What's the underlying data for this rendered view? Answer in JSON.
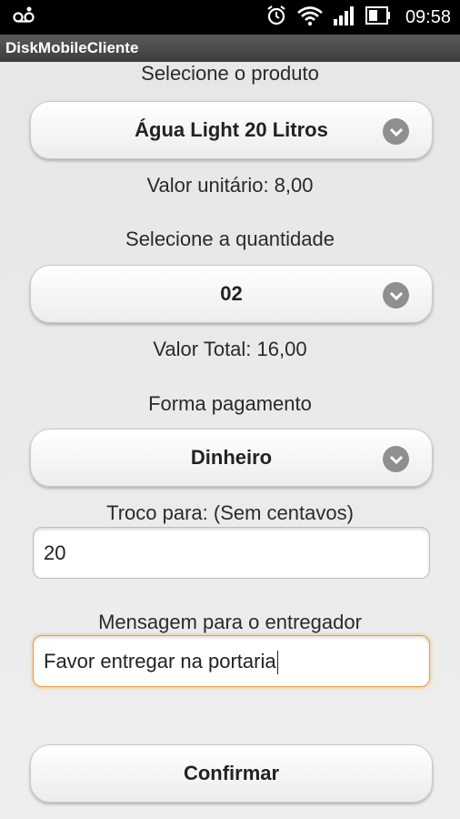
{
  "status_bar": {
    "time": "09:58",
    "icons": [
      "voicemail-icon",
      "alarm-icon",
      "wifi-icon",
      "signal-icon",
      "battery-icon"
    ]
  },
  "app": {
    "title": "DiskMobileCliente"
  },
  "product": {
    "label": "Selecione o produto",
    "selected": "Água Light 20 Litros",
    "unit_price_text": "Valor unitário: 8,00"
  },
  "quantity": {
    "label": "Selecione a quantidade",
    "selected": "02",
    "total_text": "Valor Total: 16,00"
  },
  "payment": {
    "label": "Forma pagamento",
    "selected": "Dinheiro"
  },
  "change": {
    "label": "Troco para: (Sem centavos)",
    "value": "20"
  },
  "message": {
    "label": "Mensagem para o entregador",
    "value": "Favor entregar na portaria"
  },
  "confirm": {
    "label": "Confirmar"
  },
  "colors": {
    "focus_border": "#e8a33b",
    "chevron_bg": "#8f8f8f"
  }
}
